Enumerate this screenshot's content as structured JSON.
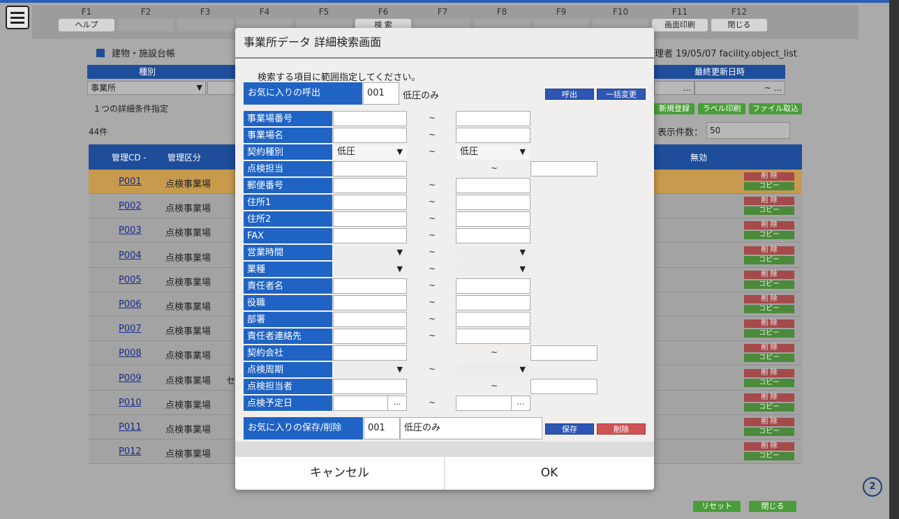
{
  "fkeys": [
    {
      "key": "F1",
      "label": "ヘルプ"
    },
    {
      "key": "F2",
      "label": ""
    },
    {
      "key": "F3",
      "label": ""
    },
    {
      "key": "F4",
      "label": ""
    },
    {
      "key": "F5",
      "label": ""
    },
    {
      "key": "F6",
      "label": "検 索"
    },
    {
      "key": "F7",
      "label": ""
    },
    {
      "key": "F8",
      "label": ""
    },
    {
      "key": "F9",
      "label": ""
    },
    {
      "key": "F10",
      "label": ""
    },
    {
      "key": "F11",
      "label": "画面印刷"
    },
    {
      "key": "F12",
      "label": "閉じる"
    }
  ],
  "page": {
    "title": "建物・施設台帳",
    "header_right": "理者 19/05/07 facility.object_list"
  },
  "filter": {
    "type_label": "種別",
    "type_value": "事業所",
    "last_updated_label": "最終更新日時",
    "detail_text": "１つの詳細条件指定",
    "count": "44件",
    "display_count_label": "表示件数：",
    "display_count_value": "50"
  },
  "actions": {
    "new": "新規登録",
    "label_print": "ラベル印刷",
    "import": "ファイル取込",
    "reset": "リセット",
    "close": "閉じる"
  },
  "table": {
    "headers": {
      "code": "管理CD -",
      "kubun": "管理区分",
      "invalid": "無効"
    },
    "delete_label": "削 除",
    "copy_label": "コピー",
    "rows": [
      {
        "code": "P001",
        "kubun": "点検事業場",
        "extra": ""
      },
      {
        "code": "P002",
        "kubun": "点検事業場",
        "extra": ""
      },
      {
        "code": "P003",
        "kubun": "点検事業場",
        "extra": ""
      },
      {
        "code": "P004",
        "kubun": "点検事業場",
        "extra": ""
      },
      {
        "code": "P005",
        "kubun": "点検事業場",
        "extra": ""
      },
      {
        "code": "P006",
        "kubun": "点検事業場",
        "extra": ""
      },
      {
        "code": "P007",
        "kubun": "点検事業場",
        "extra": ""
      },
      {
        "code": "P008",
        "kubun": "点検事業場",
        "extra": ""
      },
      {
        "code": "P009",
        "kubun": "点検事業場",
        "extra": "セ"
      },
      {
        "code": "P010",
        "kubun": "点検事業場",
        "extra": ""
      },
      {
        "code": "P011",
        "kubun": "点検事業場",
        "extra": ""
      },
      {
        "code": "P012",
        "kubun": "点検事業場",
        "extra": ""
      }
    ]
  },
  "modal": {
    "title": "事業所データ 詳細検索画面",
    "instruction": "検索する項目に範囲指定してください。",
    "fav_call_label": "お気に入りの呼出",
    "fav_call_no": "001",
    "fav_call_name": "低圧のみ",
    "call_btn": "呼出",
    "bulk_btn": "一括変更",
    "tilde": "~",
    "fields": [
      {
        "label": "事業場番号",
        "kind": "text"
      },
      {
        "label": "事業場名",
        "kind": "text"
      },
      {
        "label": "契約種別",
        "kind": "select",
        "from": "低圧",
        "to": "低圧"
      },
      {
        "label": "点検担当",
        "kind": "text_single"
      },
      {
        "label": "郵便番号",
        "kind": "text"
      },
      {
        "label": "住所1",
        "kind": "text"
      },
      {
        "label": "住所2",
        "kind": "text"
      },
      {
        "label": "FAX",
        "kind": "text"
      },
      {
        "label": "営業時間",
        "kind": "select",
        "from": "",
        "to": ""
      },
      {
        "label": "業種",
        "kind": "select",
        "from": "",
        "to": ""
      },
      {
        "label": "責任者名",
        "kind": "text"
      },
      {
        "label": "役職",
        "kind": "text"
      },
      {
        "label": "部署",
        "kind": "text"
      },
      {
        "label": "責任者連絡先",
        "kind": "text"
      },
      {
        "label": "契約会社",
        "kind": "text_single"
      },
      {
        "label": "点検周期",
        "kind": "select",
        "from": "",
        "to": ""
      },
      {
        "label": "点検担当者",
        "kind": "text_single"
      },
      {
        "label": "点検予定日",
        "kind": "date"
      }
    ],
    "fav_save_label": "お気に入りの保存/削除",
    "fav_save_no": "001",
    "fav_save_name": "低圧のみ",
    "save_btn": "保存",
    "delete_btn": "削除",
    "cancel": "キャンセル",
    "ok": "OK"
  },
  "help_badge": "2"
}
